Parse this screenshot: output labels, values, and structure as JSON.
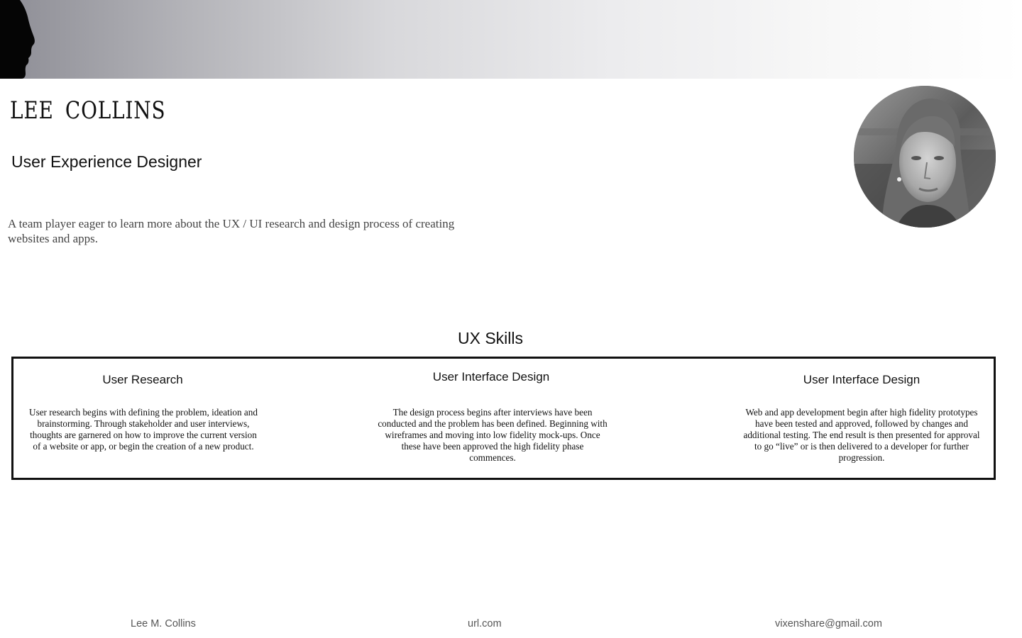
{
  "header": {
    "silhouette_icon": "head-silhouette-icon"
  },
  "profile": {
    "name": "LEE COLLINS",
    "role": "User Experience Designer",
    "summary": "A team player eager to learn more about the UX / UI research and design process of creating websites and apps.",
    "photo_icon": "profile-photo"
  },
  "skills": {
    "title": "UX Skills",
    "items": [
      {
        "title": "User Research",
        "text": "User research begins with defining the problem, ideation and brainstorming. Through stakeholder and user interviews, thoughts are garnered on how to improve the current version of a website or app, or begin the creation of a new product."
      },
      {
        "title": "User Interface Design",
        "text": "The design process begins after interviews have been conducted and the problem has been defined. Beginning with wireframes and moving into low fidelity mock-ups. Once these have been approved the high fidelity phase commences."
      },
      {
        "title": "User Interface Design",
        "text": "Web and app development begin after high fidelity prototypes have been tested and approved, followed by changes and additional testing. The end result is then presented for approval to go “live” or is then delivered to a developer for further progression."
      }
    ]
  },
  "footer": {
    "name": "Lee M. Collins",
    "url": "url.com",
    "email": "vixenshare@gmail.com"
  }
}
